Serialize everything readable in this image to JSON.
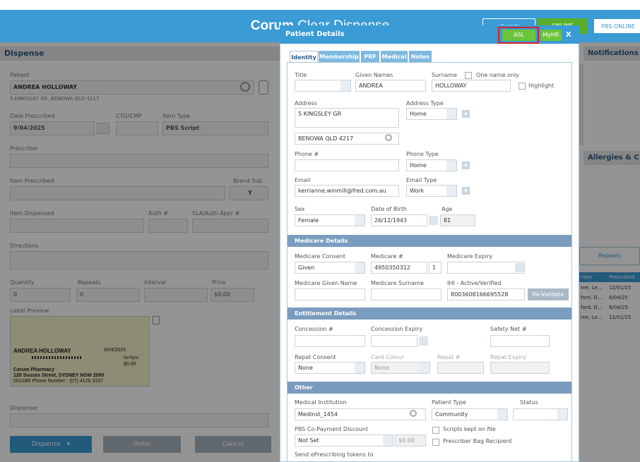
{
  "app": {
    "title_bold": "Corum",
    "title_rest": " Clear Dispense"
  },
  "header": {
    "escripts": "eScripts",
    "online": "ONLINE",
    "pbs_online": "PBS ONLINE"
  },
  "dispense": {
    "title": "Dispense",
    "patient_label": "Patient",
    "patient_name": "ANDREA HOLLOWAY",
    "patient_address": "5 KINGSLEY GR, BENOWA QLD 4217",
    "date_label": "Date Prescribed",
    "ctg_label": "CTG/CMP",
    "item_type_label": "Item Type",
    "date_value": "9/04/2025",
    "item_type_value": "PBS Script",
    "prescriber_label": "Prescriber",
    "item_prescribed_label": "Item Prescribed",
    "brand_sub_label": "Brand Sub",
    "brand_sub_value": "Y",
    "item_dispensed_label": "Item Dispensed",
    "auth_label": "Auth #",
    "sla_label": "SLA/Auth Appr #",
    "directions_label": "Directions",
    "quantity_label": "Quantity",
    "repeats_label": "Repeats",
    "interval_label": "Interval",
    "price_label": "Price",
    "quantity_value": "0",
    "repeats_value": "0",
    "price_value": "$0.00",
    "label_preview_label": "Label Preview",
    "lp_name": "ANDREA HOLLOWAY",
    "lp_date": "9/04/2025",
    "lp_rpts": "Nil Rpts",
    "lp_price": "$0.00",
    "lp_pharmacy": "Corum Pharmacy",
    "lp_street": "120 Sussex Street, SYDNEY NSW 2000",
    "lp_phone": "00128R  Phone Number : (07) 4126 3157",
    "dispenser_label": "Dispenser",
    "dispense_btn": "Dispense",
    "defer_btn": "Defer",
    "cancel_btn": "Cancel"
  },
  "right": {
    "notifications": "Notifications",
    "allergies": "Allergies & C",
    "repeats_btn": "Repeats",
    "table_headers": [
      "riber",
      "Prescribed"
    ],
    "rows": [
      [
        "ree, Le...",
        "12/01/25"
      ],
      [
        "ford, D...",
        "8/04/25"
      ],
      [
        "ford, D...",
        "8/04/25"
      ],
      [
        "ree, Le...",
        "12/01/25"
      ]
    ]
  },
  "modal": {
    "title": "Patient Details",
    "asl": "ASL",
    "myhr": "MyHR",
    "close": "X",
    "tabs": [
      "Identity",
      "Membership",
      "PRF",
      "Medical",
      "Notes"
    ],
    "title_label": "Title",
    "given_label": "Given Names",
    "surname_label": "Surname",
    "one_name_label": "One name only",
    "given_value": "ANDREA",
    "surname_value": "HOLLOWAY",
    "highlight_label": "Highlight",
    "address_label": "Address",
    "address_value": "5 KINGSLEY  GR",
    "address_type_label": "Address Type",
    "address_type_value": "Home",
    "suburb_value": "BENOWA  QLD  4217",
    "phone_label": "Phone #",
    "phone_type_label": "Phone Type",
    "phone_type_value": "Home",
    "email_label": "Email",
    "email_value": "kerrianne.winmill@fred.com.au",
    "email_type_label": "Email Type",
    "email_type_value": "Work",
    "sex_label": "Sex",
    "sex_value": "Female",
    "dob_label": "Date of Birth",
    "dob_value": "26/12/1943",
    "age_label": "Age",
    "age_value": "81",
    "medicare_section": "Medicare Details",
    "consent_label": "Medicare Consent",
    "consent_value": "Given",
    "medicare_no_label": "Medicare #",
    "medicare_no_value": "4950350312",
    "medicare_irn": "1",
    "expiry_label": "Medicare Expiry",
    "mc_given_label": "Medicare Given Name",
    "mc_surname_label": "Medicare Surname",
    "ihi_label": "IHI - Active/Verified",
    "ihi_value": "8003608166695528",
    "revalidate": "Re-Validate",
    "entitlement_section": "Entitlement Details",
    "concession_label": "Concession #",
    "concession_expiry_label": "Concession Expiry",
    "safety_net_label": "Safety Net #",
    "repat_consent_label": "Repat Consent",
    "repat_consent_value": "None",
    "card_colour_label": "Card Colour",
    "card_colour_value": "None",
    "repat_no_label": "Repat #",
    "repat_expiry_label": "Repat Expiry",
    "other_section": "Other",
    "med_inst_label": "Medical Institution",
    "med_inst_value": "MedInst_1454",
    "patient_type_label": "Patient Type",
    "patient_type_value": "Community",
    "status_label": "Status",
    "copay_label": "PBS Co-Payment Discount",
    "copay_value": "Not Set",
    "copay_amount": "$0.00",
    "scripts_kept_label": "Scripts kept on file",
    "bag_recipient_label": "Prescriber Bag Recipient",
    "send_tokens_label": "Send ePrescribing tokens to"
  },
  "colors": {
    "accent": "#3a9bd5",
    "online_green": "#5aae2a",
    "asl_green": "#6cc43a",
    "highlight_red": "#d0202a"
  }
}
